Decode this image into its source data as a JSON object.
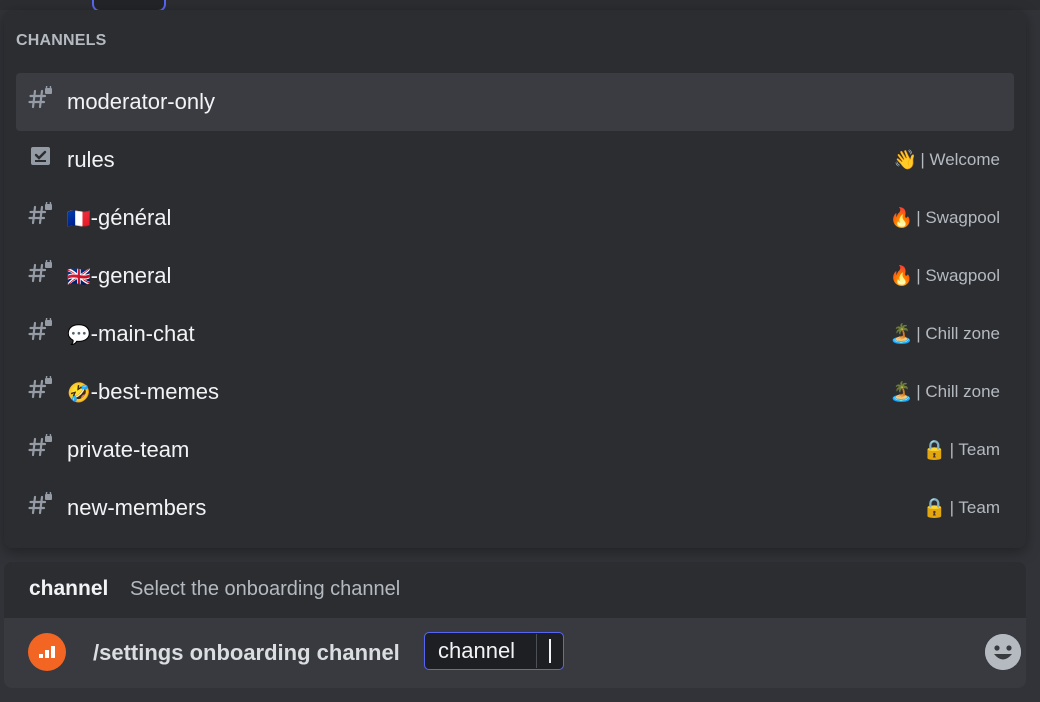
{
  "popup": {
    "header": "CHANNELS",
    "channels": [
      {
        "icon": "locked-text-channel-icon",
        "emoji": "",
        "name": "moderator-only",
        "category_emoji": "",
        "category": ""
      },
      {
        "icon": "rules-channel-icon",
        "emoji": "",
        "name": "rules",
        "category_emoji": "👋",
        "category": "| Welcome"
      },
      {
        "icon": "locked-text-channel-icon",
        "emoji": "🇫🇷",
        "name": "-général",
        "category_emoji": "🔥",
        "category": "| Swagpool"
      },
      {
        "icon": "locked-text-channel-icon",
        "emoji": "🇬🇧",
        "name": "-general",
        "category_emoji": "🔥",
        "category": "| Swagpool"
      },
      {
        "icon": "locked-text-channel-icon",
        "emoji": "💬",
        "name": "-main-chat",
        "category_emoji": "🏝️",
        "category": "| Chill zone"
      },
      {
        "icon": "locked-text-channel-icon",
        "emoji": "🤣",
        "name": "-best-memes",
        "category_emoji": "🏝️",
        "category": "| Chill zone"
      },
      {
        "icon": "locked-text-channel-icon",
        "emoji": "",
        "name": "private-team",
        "category_emoji": "🔒",
        "category": "| Team"
      },
      {
        "icon": "locked-text-channel-icon",
        "emoji": "",
        "name": "new-members",
        "category_emoji": "🔒",
        "category": "| Team"
      }
    ]
  },
  "option": {
    "name": "channel",
    "description": "Select the onboarding channel"
  },
  "input": {
    "command": "/settings onboarding channel",
    "option_label": "channel"
  },
  "colors": {
    "accent": "#5865f2",
    "bot_avatar": "#f26522",
    "active_row": "#3a3c42"
  }
}
